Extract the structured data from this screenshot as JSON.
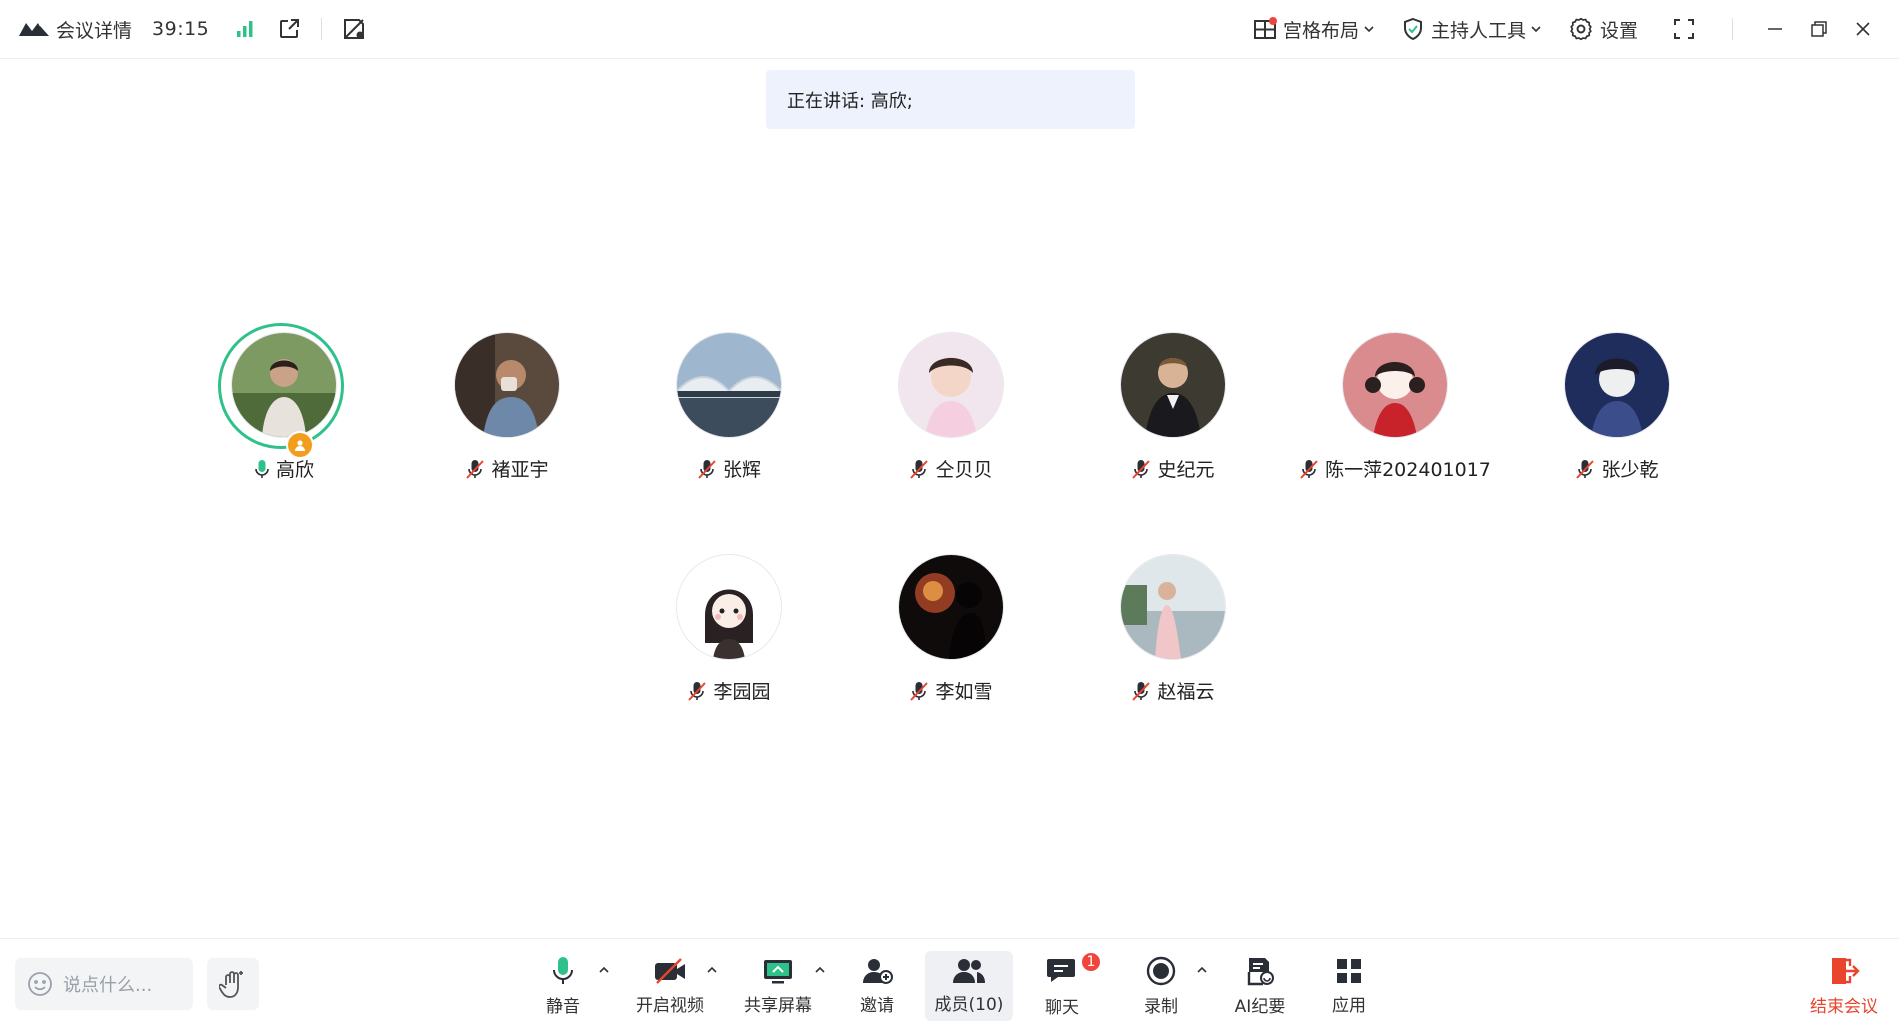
{
  "header": {
    "title": "会议详情",
    "timer": "39:15",
    "layout_label": "宫格布局",
    "host_tools_label": "主持人工具",
    "settings_label": "设置"
  },
  "banner": {
    "speaking_text": "正在讲话: 高欣;"
  },
  "participants": [
    {
      "name": "高欣",
      "muted": false,
      "is_host": true,
      "speaking": true
    },
    {
      "name": "褚亚宇",
      "muted": true
    },
    {
      "name": "张辉",
      "muted": true
    },
    {
      "name": "仝贝贝",
      "muted": true
    },
    {
      "name": "史纪元",
      "muted": true
    },
    {
      "name": "陈一萍202401017",
      "muted": true
    },
    {
      "name": "张少乾",
      "muted": true
    },
    {
      "name": "李园园",
      "muted": true
    },
    {
      "name": "李如雪",
      "muted": true
    },
    {
      "name": "赵福云",
      "muted": true
    }
  ],
  "footer": {
    "chat_placeholder": "说点什么...",
    "mute_label": "静音",
    "video_label": "开启视频",
    "share_label": "共享屏幕",
    "invite_label": "邀请",
    "members_label": "成员(10)",
    "chat_label": "聊天",
    "chat_badge": "1",
    "record_label": "录制",
    "ai_label": "AI纪要",
    "apps_label": "应用",
    "end_label": "结束会议"
  },
  "colors": {
    "accent_green": "#2ec28a",
    "mute_red": "#e8442e",
    "badge_red": "#f0443c",
    "host_orange": "#f29d1d",
    "banner_bg": "#edf2fd"
  }
}
